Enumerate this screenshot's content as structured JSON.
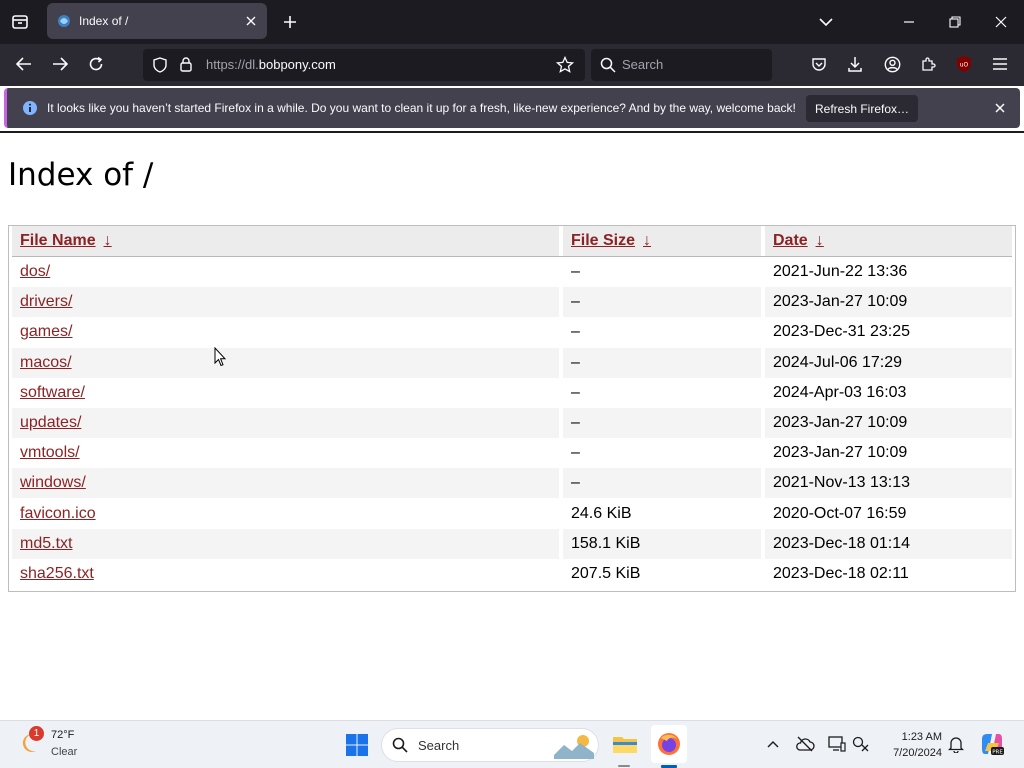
{
  "browser": {
    "tab_title": "Index of /",
    "url_prefix": "https://dl.",
    "url_host": "bobpony.com",
    "search_placeholder": "Search",
    "notification": {
      "message": "It looks like you haven’t started Firefox in a while. Do you want to clean it up for a fresh, like-new experience? And by the way, welcome back!",
      "button": "Refresh Firefox…"
    },
    "accent": "#c665e4"
  },
  "page": {
    "title": "Index of /",
    "columns": [
      {
        "label": "File Name",
        "arrow": "↓"
      },
      {
        "label": "File Size",
        "arrow": "↓"
      },
      {
        "label": "Date",
        "arrow": "↓"
      }
    ],
    "rows": [
      {
        "name": "dos/",
        "size": "–",
        "date": "2021-Jun-22 13:36"
      },
      {
        "name": "drivers/",
        "size": "–",
        "date": "2023-Jan-27 10:09"
      },
      {
        "name": "games/",
        "size": "–",
        "date": "2023-Dec-31 23:25"
      },
      {
        "name": "macos/",
        "size": "–",
        "date": "2024-Jul-06 17:29"
      },
      {
        "name": "software/",
        "size": "–",
        "date": "2024-Apr-03 16:03"
      },
      {
        "name": "updates/",
        "size": "–",
        "date": "2023-Jan-27 10:09"
      },
      {
        "name": "vmtools/",
        "size": "–",
        "date": "2023-Jan-27 10:09"
      },
      {
        "name": "windows/",
        "size": "–",
        "date": "2021-Nov-13 13:13"
      },
      {
        "name": "favicon.ico",
        "size": "24.6 KiB",
        "date": "2020-Oct-07 16:59"
      },
      {
        "name": "md5.txt",
        "size": "158.1 KiB",
        "date": "2023-Dec-18 01:14"
      },
      {
        "name": "sha256.txt",
        "size": "207.5 KiB",
        "date": "2023-Dec-18 02:11"
      }
    ],
    "link_color": "#8b2325"
  },
  "taskbar": {
    "weather_badge": "1",
    "temperature": "72°F",
    "condition": "Clear",
    "search_placeholder": "Search",
    "time": "1:23 AM",
    "date": "7/20/2024"
  }
}
